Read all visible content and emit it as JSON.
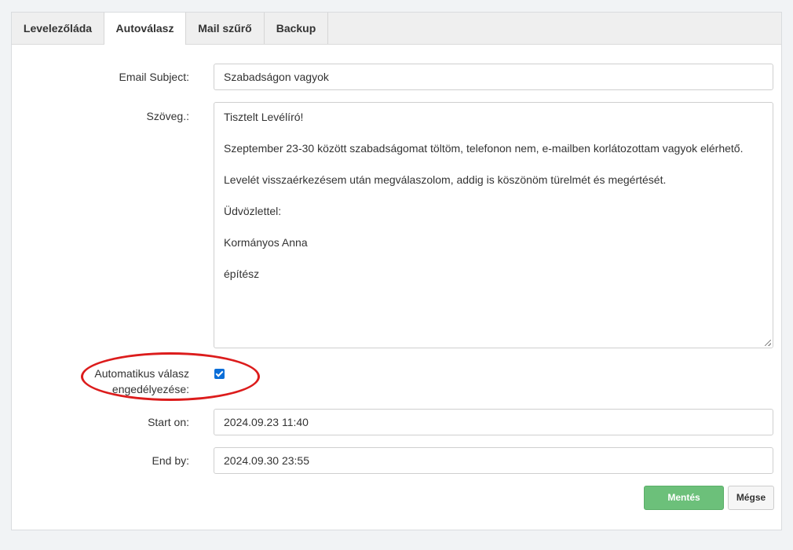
{
  "tabs": [
    {
      "label": "Levelezőláda"
    },
    {
      "label": "Autoválasz"
    },
    {
      "label": "Mail szűrő"
    },
    {
      "label": "Backup"
    }
  ],
  "form": {
    "subject": {
      "label": "Email Subject:",
      "value": "Szabadságon vagyok"
    },
    "body": {
      "label": "Szöveg.:",
      "paragraphs": [
        "Tisztelt Levélíró!",
        "Szeptember 23-30 között szabadságomat töltöm, telefonon nem, e-mailben korlátozottam vagyok elérhető.",
        "Levelét visszaérkezésem után megválaszolom, addig is köszönöm türelmét és megértését.",
        "Üdvözlettel:",
        "Kormányos Anna",
        "építész"
      ]
    },
    "auto_reply": {
      "label_line1": "Automatikus válasz",
      "label_line2": "engedélyezése:",
      "checked": true
    },
    "start": {
      "label": "Start on:",
      "value": "2024.09.23 11:40"
    },
    "end": {
      "label": "End by:",
      "value": "2024.09.30 23:55"
    }
  },
  "buttons": {
    "save": "Mentés",
    "cancel": "Mégse"
  },
  "colors": {
    "save_button": "#6cc07a",
    "highlight": "#dc1c1c",
    "checkbox": "#0b6ed8"
  }
}
